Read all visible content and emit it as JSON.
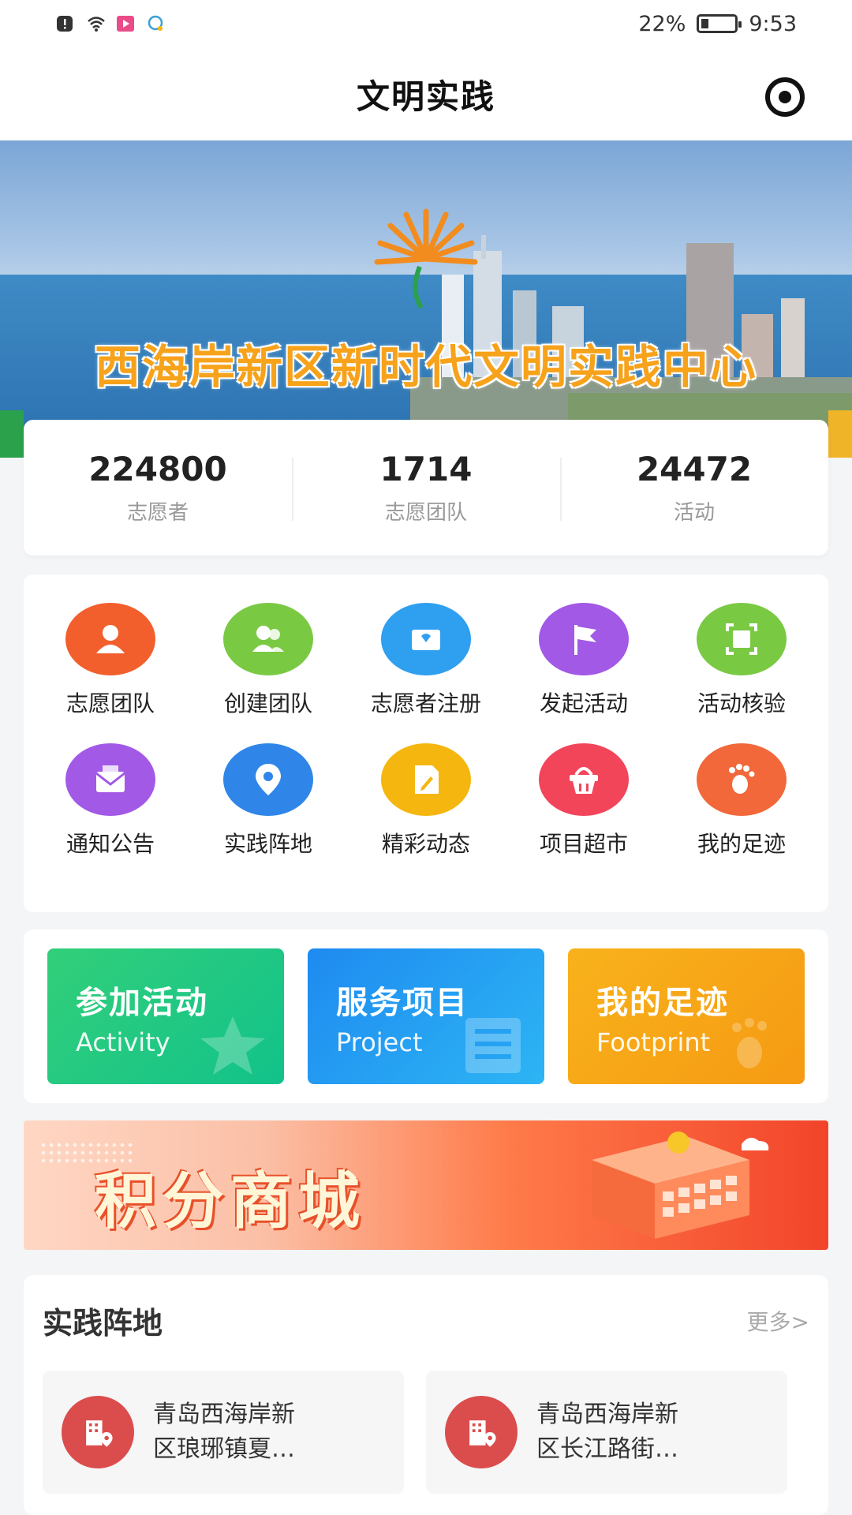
{
  "status_bar": {
    "battery_percent": "22%",
    "time": "9:53",
    "battery_level": 0.22,
    "left_icons": [
      "alert-icon",
      "wifi-icon",
      "video-app-icon",
      "chat-app-icon"
    ]
  },
  "header": {
    "title": "文明实践",
    "action_icon": "target-icon"
  },
  "banner": {
    "title": "西海岸新区新时代文明实践中心"
  },
  "stats": [
    {
      "value": "224800",
      "label": "志愿者"
    },
    {
      "value": "1714",
      "label": "志愿团队"
    },
    {
      "value": "24472",
      "label": "活动"
    }
  ],
  "quick_actions": [
    {
      "label": "志愿团队",
      "icon": "user-icon",
      "color": "#f25f2c"
    },
    {
      "label": "创建团队",
      "icon": "team-icon",
      "color": "#7ac943"
    },
    {
      "label": "志愿者注册",
      "icon": "register-mail-icon",
      "color": "#2f9ff0"
    },
    {
      "label": "发起活动",
      "icon": "flag-icon",
      "color": "#a259e6"
    },
    {
      "label": "活动核验",
      "icon": "scan-icon",
      "color": "#7ac943"
    },
    {
      "label": "通知公告",
      "icon": "notice-mail-icon",
      "color": "#a259e6"
    },
    {
      "label": "实践阵地",
      "icon": "location-pin-icon",
      "color": "#2f86e8"
    },
    {
      "label": "精彩动态",
      "icon": "edit-document-icon",
      "color": "#f5b70f"
    },
    {
      "label": "项目超市",
      "icon": "basket-icon",
      "color": "#f2455a"
    },
    {
      "label": "我的足迹",
      "icon": "footprint-icon",
      "color": "#f2683a"
    }
  ],
  "feature_tiles": [
    {
      "title": "参加活动",
      "subtitle": "Activity"
    },
    {
      "title": "服务项目",
      "subtitle": "Project"
    },
    {
      "title": "我的足迹",
      "subtitle": "Footprint"
    }
  ],
  "mall_banner": {
    "title": "积分商城"
  },
  "practice_base": {
    "title": "实践阵地",
    "more": "更多>",
    "items": [
      {
        "name_line1": "青岛西海岸新",
        "name_line2": "区琅琊镇夏…"
      },
      {
        "name_line1": "青岛西海岸新",
        "name_line2": "区长江路街…"
      }
    ]
  }
}
